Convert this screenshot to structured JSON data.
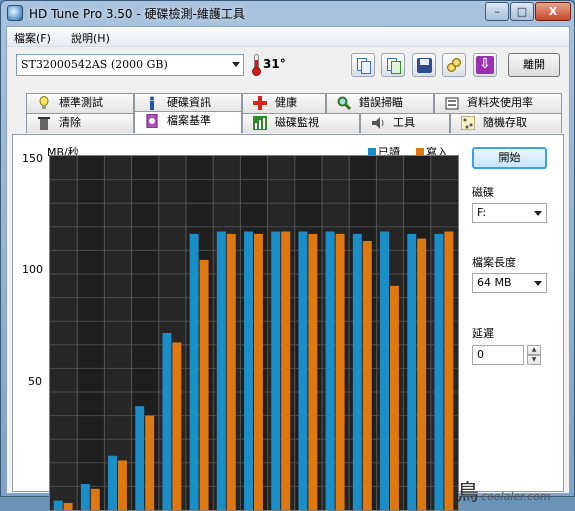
{
  "window": {
    "title": "HD Tune Pro 3.50 - 硬碟檢測-維護工具",
    "min_glyph": "–",
    "max_glyph": "□",
    "close_glyph": "X"
  },
  "menu": {
    "file": "檔案(F)",
    "help": "說明(H)"
  },
  "toolbar": {
    "drive": "ST32000542AS (2000 GB)",
    "temperature": "31°",
    "exit_label": "離開",
    "down_glyph": "⇩"
  },
  "tabs_row1": [
    {
      "label": "標準測試",
      "icon": "lightbulb-icon"
    },
    {
      "label": "硬碟資訊",
      "icon": "info-icon"
    },
    {
      "label": "健康",
      "icon": "health-cross-icon"
    },
    {
      "label": "錯誤掃瞄",
      "icon": "magnifier-icon"
    },
    {
      "label": "資料夾使用率",
      "icon": "folder-icon"
    }
  ],
  "tabs_row2": [
    {
      "label": "清除",
      "icon": "trash-icon"
    },
    {
      "label": "檔案基準",
      "icon": "file-benchmark-icon",
      "active": true
    },
    {
      "label": "磁碟監視",
      "icon": "monitor-icon"
    },
    {
      "label": "工具",
      "icon": "speaker-icon"
    },
    {
      "label": "隨機存取",
      "icon": "random-access-icon"
    }
  ],
  "side": {
    "start_label": "開始",
    "disk_label": "磁碟",
    "disk_value": "F:",
    "file_length_label": "檔案長度",
    "file_length_value": "64 MB",
    "delay_label": "延遲",
    "delay_value": "0"
  },
  "watermark": {
    "glyph": "鳥",
    "text": "coolaler.com"
  },
  "chart_data": {
    "type": "bar",
    "ylabel": "MB/秒",
    "ylim": [
      0,
      150
    ],
    "yticks": [
      50,
      100,
      150
    ],
    "series": [
      {
        "name": "已讀",
        "color": "#1a8ec9",
        "values": [
          4,
          11,
          23,
          44,
          75,
          117,
          118,
          118,
          118,
          118,
          118,
          117,
          118,
          117,
          117
        ]
      },
      {
        "name": "寫入",
        "color": "#e07810",
        "values": [
          3,
          9,
          21,
          40,
          71,
          106,
          117,
          117,
          118,
          117,
          117,
          114,
          95,
          115,
          118
        ]
      }
    ],
    "grid": true,
    "legend": "top-right"
  }
}
